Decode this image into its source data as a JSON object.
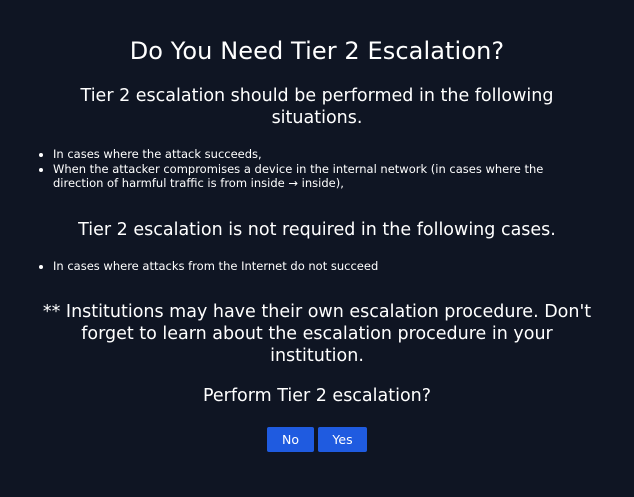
{
  "dialog": {
    "title": "Do You Need Tier 2 Escalation?",
    "required_heading": "Tier 2 escalation should be performed in the following situations.",
    "required_cases": [
      "In cases where the attack succeeds,",
      "When the attacker compromises a device in the internal network (in cases where the direction of harmful traffic is from inside → inside),"
    ],
    "not_required_heading": "Tier 2 escalation is not required in the following cases.",
    "not_required_cases": [
      "In cases where attacks from the Internet do not succeed"
    ],
    "note": "** Institutions may have their own escalation procedure. Don't forget to learn about the escalation procedure in your institution.",
    "question": "Perform Tier 2 escalation?",
    "buttons": {
      "no_label": "No",
      "yes_label": "Yes"
    }
  },
  "colors": {
    "background": "#0f1523",
    "text": "#ffffff",
    "button": "#1f5be0"
  }
}
